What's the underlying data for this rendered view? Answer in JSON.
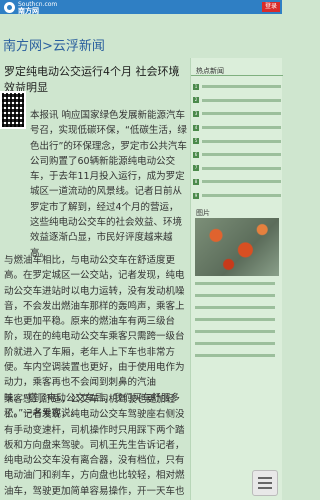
{
  "header": {
    "logo_line1": "Southcn.com",
    "logo_line2": "南方网",
    "login_label": "登录"
  },
  "channel": {
    "title": "南方网>云浮新闻"
  },
  "article": {
    "title": "罗定纯电动公交运行4个月 社会环境效益明显",
    "paragraphs": [
      "本报讯 响应国家绿色发展新能源汽车号召，实现低碳环保，“低碳生活，绿色出行”的环保理念，罗定市公共汽车公司购置了60辆新能源纯电动公交车，于去年11月投入运行，成为罗定城区一道流动的风景线。记者日前从罗定市了解到，经过4个月的营运，这些纯电动公交车的社会效益、环境效益逐渐凸显，市民好评度越来越高。",
      "与燃油车相比，与电动公交车在舒适度更高。在罗定城区一公交站，记者发现，纯电动公交车进站时以电力运转，没有发动机噪音，不会发出燃油车那样的轰鸣声，乘客上车也更加平稳。原来的燃油车有两三级台阶，现在的纯电动公交车乘客只需跨一级台阶就进入了车厢，老年人上下车也非常方便。车内空调装置也更好，由于使用电作为动力，乘客再也不会闻到刺鼻的汽油味。“搭了电动公交车后，我们买车舒服多了。”一名乘客说。",
      "乘客感到舒适，公交车司机驾驶也更加轻松。记者发现，纯电动公交车驾驶座右侧没有手动变速杆，司机操作时只用踩下两个踏板和方向盘来驾驶。司机王先生告诉记者，纯电动公交车没有离合器，没有档位，只有电动油门和刹车，方向盘也比较轻，相对燃油车，驾驶更加简单容易操作，开一天车也不会感到很累。"
    ]
  },
  "sidebar": {
    "section1_title": "热点新闻",
    "section2_title": "图片"
  },
  "icons": {
    "logo": "southcn-logo-icon",
    "qr": "qr-code-icon",
    "share": "share-icons",
    "menu": "menu-icon"
  },
  "colors": {
    "topbar": "#2f7fc4",
    "background": "#cfe6cf",
    "channel": "#2a5f9e",
    "login": "#d92b2b"
  }
}
